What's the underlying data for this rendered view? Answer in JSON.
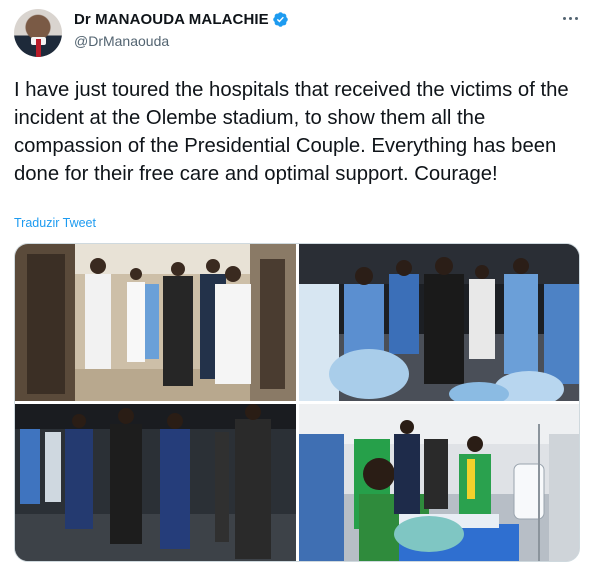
{
  "author": {
    "display_name": "Dr MANAOUDA MALACHIE",
    "handle": "@DrManaouda",
    "verified": true
  },
  "tweet": {
    "text": "I have just toured the hospitals that received the victims of the incident at the Olembe stadium, to show them all the compassion of the Presidential Couple. Everything has been done for their free care and optimal support. Courage!",
    "translate_label": "Traduzir Tweet"
  },
  "media": {
    "count": 4
  },
  "icons": {
    "more": "more-options-icon",
    "verified": "verified-badge-icon"
  },
  "colors": {
    "accent": "#1d9bf0",
    "text": "#0f1419",
    "secondary": "#536471",
    "border": "#cfd9de"
  }
}
